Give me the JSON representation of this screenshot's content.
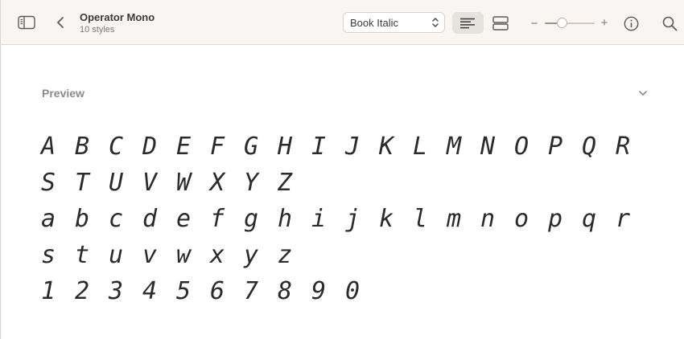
{
  "header": {
    "font_family": "Operator Mono",
    "style_count": "10 styles",
    "style_select": "Book Italic"
  },
  "icons": {
    "sidebar": "sidebar-toggle-icon",
    "back": "chevron-left-icon",
    "align": "text-align-icon",
    "stack": "stacked-rows-icon",
    "minus": "zoom-out-icon",
    "plus": "zoom-in-icon",
    "info": "info-icon",
    "search": "search-icon"
  },
  "zoom": {
    "minus": "−",
    "plus": "+",
    "level": 0.35
  },
  "preview": {
    "section_title": "Preview",
    "rows": [
      [
        "A",
        "B",
        "C",
        "D",
        "E",
        "F",
        "G",
        "H",
        "I",
        "J",
        "K",
        "L",
        "M",
        "N",
        "O",
        "P",
        "Q",
        "R"
      ],
      [
        "S",
        "T",
        "U",
        "V",
        "W",
        "X",
        "Y",
        "Z"
      ],
      [
        "a",
        "b",
        "c",
        "d",
        "e",
        "f",
        "g",
        "h",
        "i",
        "j",
        "k",
        "l",
        "m",
        "n",
        "o",
        "p",
        "q",
        "r"
      ],
      [
        "s",
        "t",
        "u",
        "v",
        "w",
        "x",
        "y",
        "z"
      ],
      [
        "1",
        "2",
        "3",
        "4",
        "5",
        "6",
        "7",
        "8",
        "9",
        "0"
      ]
    ]
  }
}
